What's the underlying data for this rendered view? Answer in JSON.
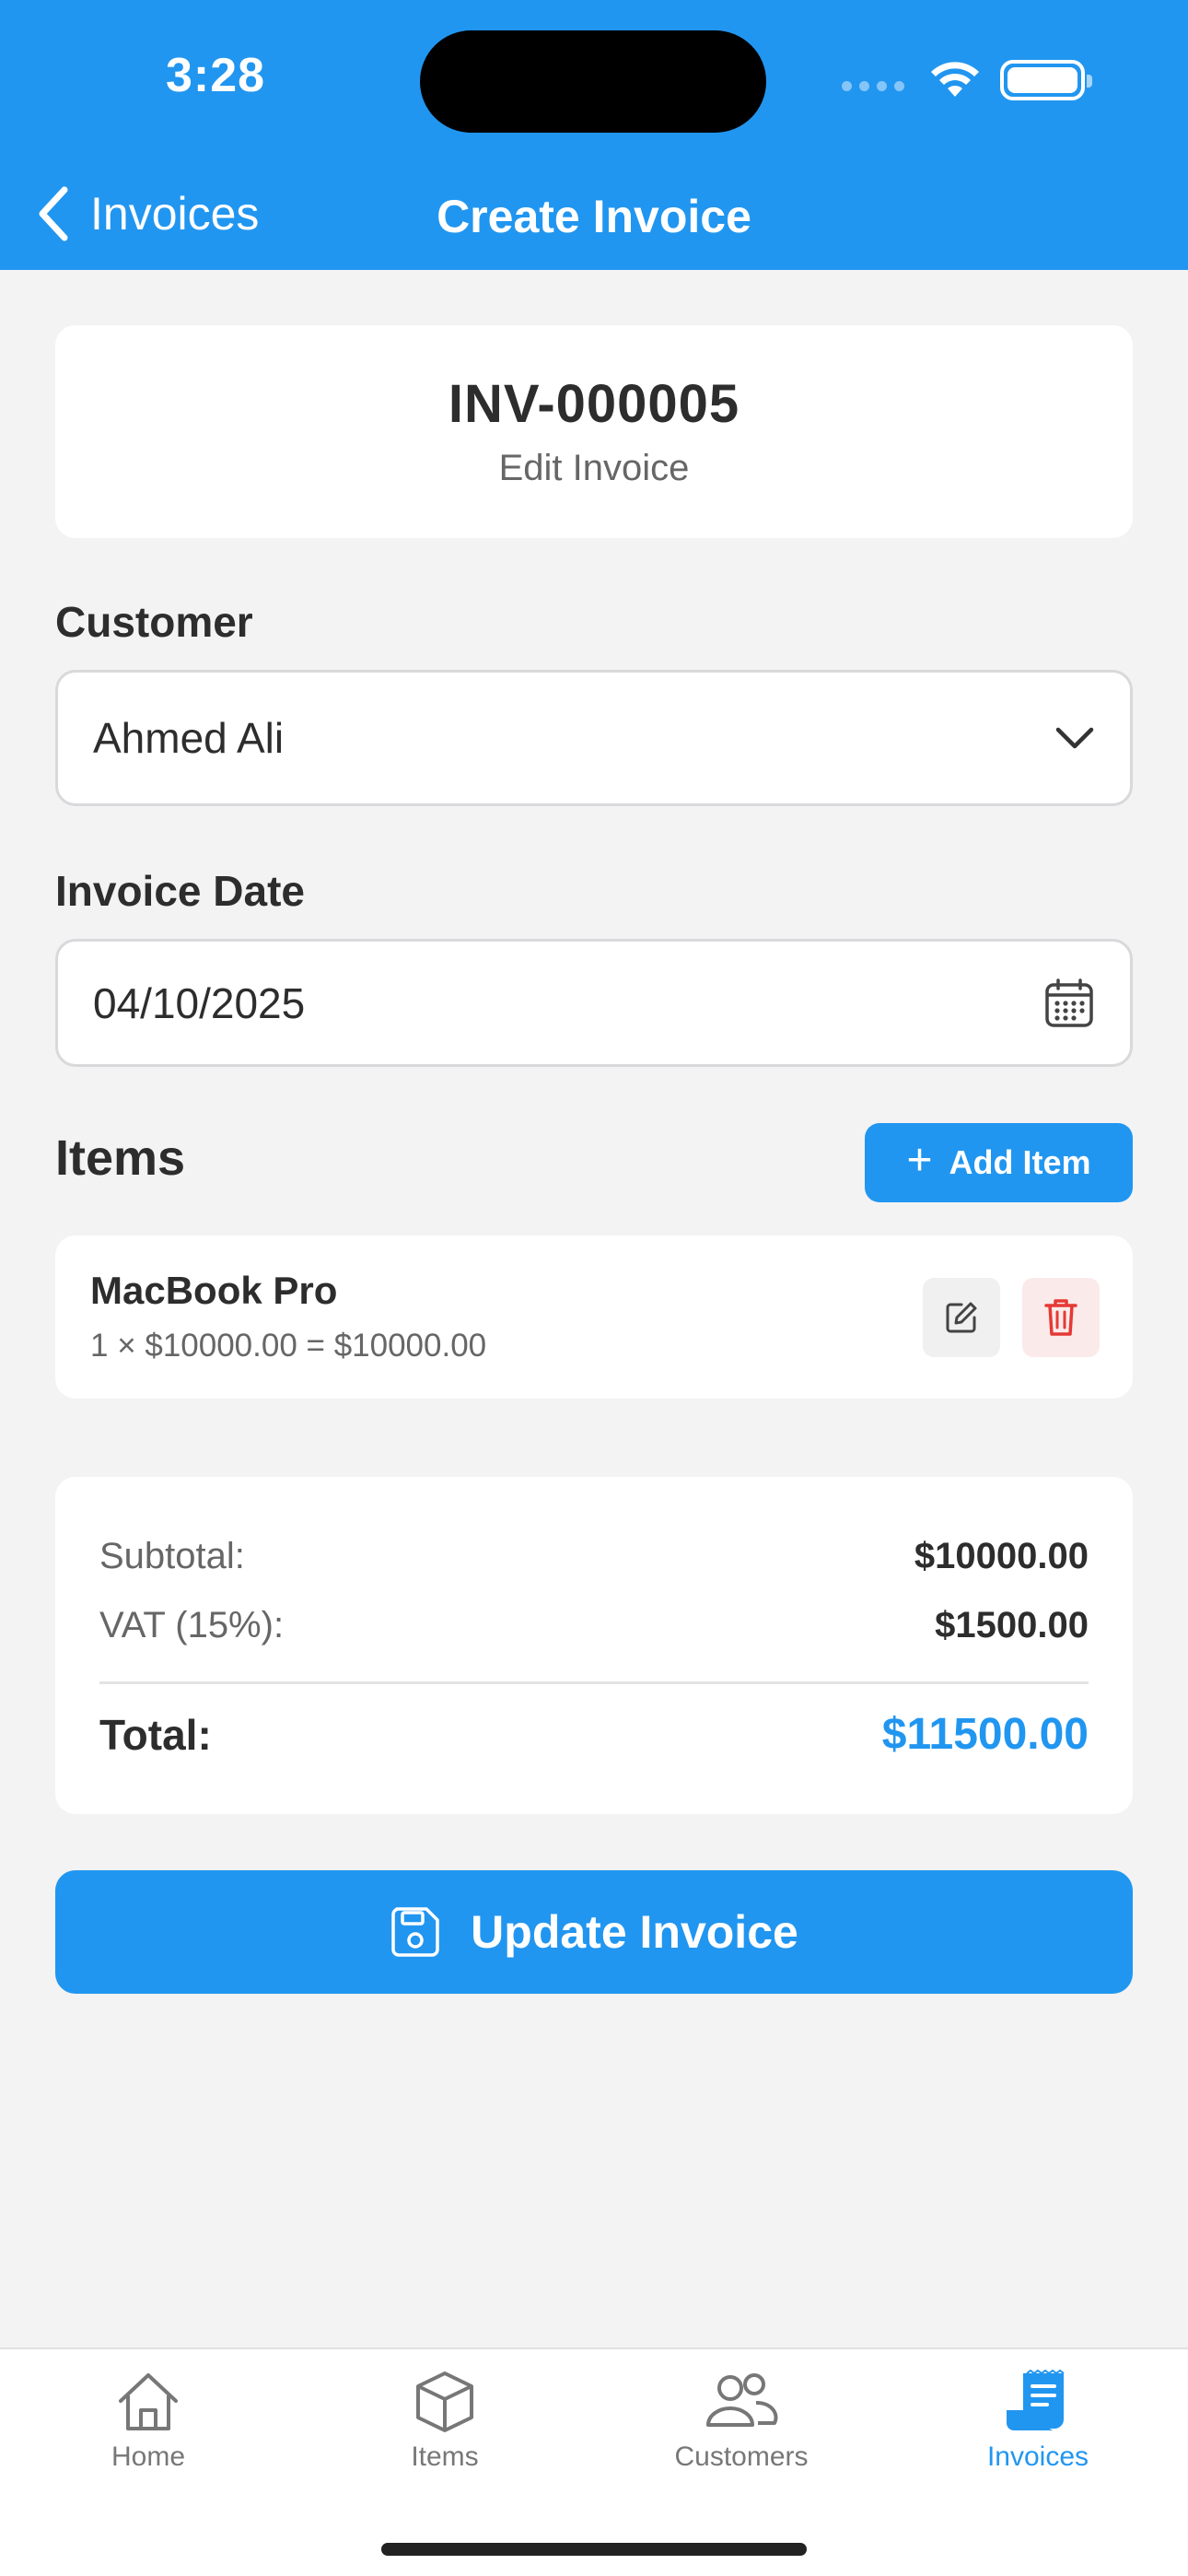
{
  "status_bar": {
    "time": "3:28"
  },
  "nav": {
    "back_label": "Invoices",
    "title": "Create Invoice"
  },
  "invoice": {
    "number": "INV-000005",
    "subtitle": "Edit Invoice"
  },
  "form": {
    "customer_label": "Customer",
    "customer_value": "Ahmed Ali",
    "date_label": "Invoice Date",
    "date_value": "04/10/2025"
  },
  "items_section": {
    "title": "Items",
    "add_button": "Add Item",
    "items": [
      {
        "name": "MacBook Pro",
        "calc": "1 × $10000.00 = $10000.00"
      }
    ]
  },
  "totals": {
    "subtotal_label": "Subtotal:",
    "subtotal_value": "$10000.00",
    "vat_label": "VAT (15%):",
    "vat_value": "$1500.00",
    "total_label": "Total:",
    "total_value": "$11500.00"
  },
  "update_button": "Update Invoice",
  "tabbar": {
    "tabs": [
      {
        "label": "Home",
        "icon": "home-icon"
      },
      {
        "label": "Items",
        "icon": "box-icon"
      },
      {
        "label": "Customers",
        "icon": "users-icon"
      },
      {
        "label": "Invoices",
        "icon": "invoice-icon",
        "active": true
      }
    ]
  },
  "colors": {
    "primary": "#2196f0",
    "danger": "#e53935",
    "background": "#f3f3f4"
  }
}
